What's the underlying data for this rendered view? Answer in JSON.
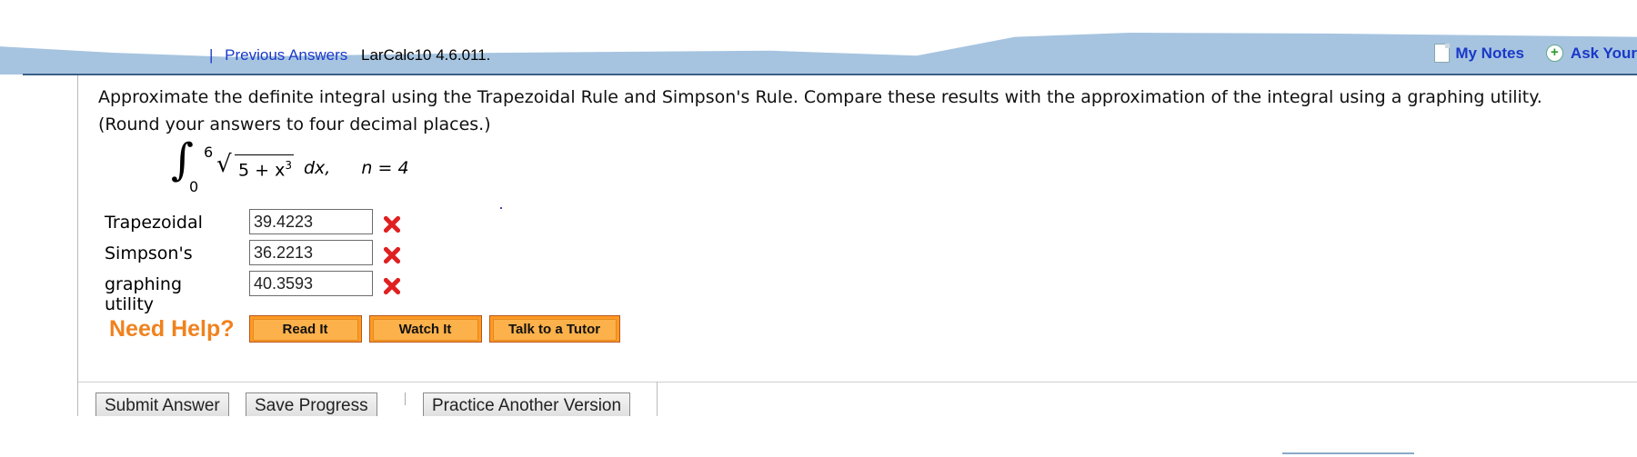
{
  "header": {
    "previous_answers": "Previous Answers",
    "separator": "|",
    "problem_code": "LarCalc10 4.6.011.",
    "my_notes": "My Notes",
    "ask_your": "Ask Your"
  },
  "question": {
    "line1": "Approximate the definite integral using the Trapezoidal Rule and Simpson's Rule. Compare these results with the approximation of the integral using a graphing utility.",
    "line2": "(Round your answers to four decimal places.)"
  },
  "integral": {
    "upper": "6",
    "lower": "0",
    "radicand": "5 + x",
    "exponent": "3",
    "differential": "dx,",
    "n": "n = 4"
  },
  "answers": [
    {
      "label": "Trapezoidal",
      "value": "39.4223",
      "status": "incorrect"
    },
    {
      "label": "Simpson's",
      "value": "36.2213",
      "status": "incorrect"
    },
    {
      "label": "graphing utility",
      "value": "40.3593",
      "status": "incorrect"
    }
  ],
  "help": {
    "title": "Need Help?",
    "read_it": "Read It",
    "watch_it": "Watch It",
    "talk_to_tutor": "Talk to a Tutor"
  },
  "actions": {
    "submit": "Submit Answer",
    "save": "Save Progress",
    "practice": "Practice Another Version"
  },
  "colors": {
    "header_bg": "#a6c4e0",
    "link": "#1a39c8",
    "help_orange": "#f0821e",
    "error_red": "#e02020"
  }
}
